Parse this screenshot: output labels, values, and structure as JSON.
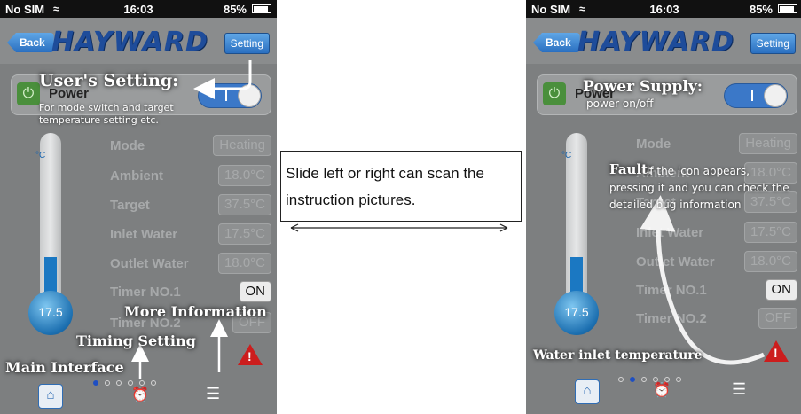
{
  "left": {
    "status": {
      "carrier": "No SIM",
      "time": "16:03",
      "battery": "85%"
    },
    "header": {
      "back_label": "Back",
      "logo": "HAYWARD",
      "setting_label": "Setting"
    },
    "power_label": "Power",
    "thermometer": {
      "unit": "°C",
      "value": "17.5"
    },
    "params": [
      {
        "label": "Mode",
        "value": "Heating"
      },
      {
        "label": "Ambient",
        "value": "18.0°C"
      },
      {
        "label": "Target",
        "value": "37.5°C"
      },
      {
        "label": "Inlet Water",
        "value": "17.5°C"
      },
      {
        "label": "Outlet Water",
        "value": "18.0°C"
      },
      {
        "label": "Timer NO.1",
        "value": "ON"
      },
      {
        "label": "Timer NO.2",
        "value": "OFF"
      }
    ],
    "annotations": {
      "users_setting": "User's Setting:",
      "users_setting_sub": "For mode switch and target temperature setting etc.",
      "more_info": "More Information",
      "timing": "Timing Setting",
      "main": "Main Interface"
    },
    "active_page": 1,
    "page_count": 6
  },
  "middle": {
    "text": "Slide left or right can scan the instruction pictures."
  },
  "right": {
    "status": {
      "carrier": "No SIM",
      "time": "16:03",
      "battery": "85%"
    },
    "header": {
      "back_label": "Back",
      "logo": "HAYWARD",
      "setting_label": "Setting"
    },
    "power_label": "Power",
    "thermometer": {
      "unit": "°C",
      "value": "17.5"
    },
    "params": [
      {
        "label": "Mode",
        "value": "Heating"
      },
      {
        "label": "Ambient",
        "value": "18.0°C"
      },
      {
        "label": "Target",
        "value": "37.5°C"
      },
      {
        "label": "Inlet Water",
        "value": "17.5°C"
      },
      {
        "label": "Outlet Water",
        "value": "18.0°C"
      },
      {
        "label": "Timer NO.1",
        "value": "ON"
      },
      {
        "label": "Timer NO.2",
        "value": "OFF"
      }
    ],
    "annotations": {
      "power_supply": "Power Supply:",
      "power_supply_sub": "power on/off",
      "fault": "Fault:",
      "fault_sub": "if the icon appears, pressing it and you can check the detailed bug information",
      "water_inlet": "Water inlet temperature"
    },
    "active_page": 2,
    "page_count": 6
  },
  "colors": {
    "brand": "#1e4c9a",
    "accent": "#2a6fc0",
    "alarm": "#cc1d1d",
    "power": "#4a8f3c"
  },
  "icons": [
    "wifi-icon",
    "battery-icon",
    "power-icon",
    "alarm-icon",
    "home-icon",
    "clock-icon",
    "menu-icon"
  ]
}
